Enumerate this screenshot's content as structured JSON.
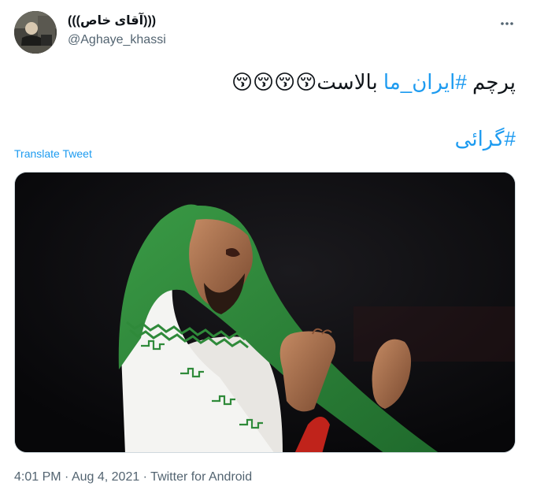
{
  "tweet": {
    "display_name": "(((آقای خاص)))",
    "handle": "@Aghaye_khassi",
    "text_before_hashtag": "پرچم ",
    "hashtag_1": "#ایران_ما",
    "text_after_hashtag": " بالاست",
    "emojis": "😚😚😚😚",
    "hashtag_2": "#گرائی",
    "translate_label": "Translate Tweet",
    "time": "4:01 PM",
    "separator_1": " · ",
    "date": "Aug 4, 2021",
    "separator_2": " · ",
    "source": "Twitter for Android"
  },
  "icons": {
    "more": "more-horizontal-icon"
  },
  "colors": {
    "link": "#1d9bf0",
    "secondary_text": "#536471",
    "flag_green": "#2f8a3a",
    "flag_white": "#f4f4f2",
    "flag_red": "#c0231b"
  }
}
